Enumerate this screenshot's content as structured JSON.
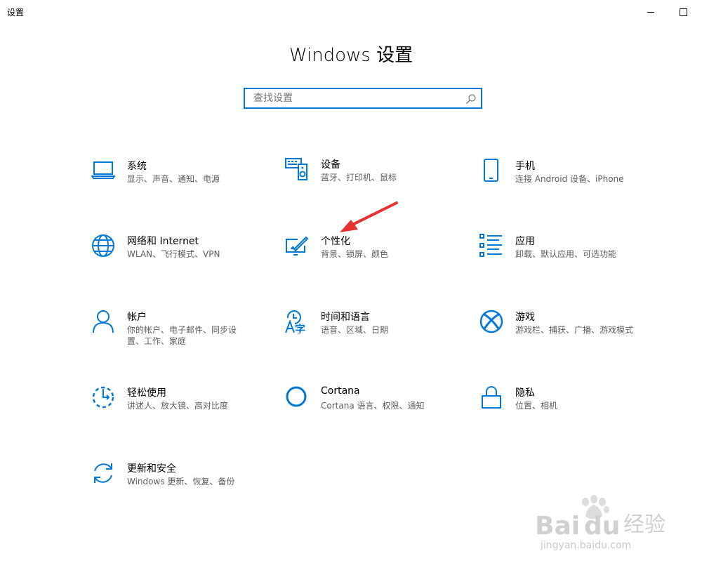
{
  "window": {
    "title": "设置"
  },
  "header": {
    "title": "Windows 设置"
  },
  "search": {
    "placeholder": "查找设置"
  },
  "tiles": [
    {
      "label": "系统",
      "desc": "显示、声音、通知、电源",
      "icon": "laptop-icon"
    },
    {
      "label": "设备",
      "desc": "蓝牙、打印机、鼠标",
      "icon": "keyboard-speaker-icon"
    },
    {
      "label": "手机",
      "desc": "连接 Android 设备、iPhone",
      "icon": "phone-icon"
    },
    {
      "label": "网络和 Internet",
      "desc": "WLAN、飞行模式、VPN",
      "icon": "globe-icon"
    },
    {
      "label": "个性化",
      "desc": "背景、锁屏、颜色",
      "icon": "pen-tablet-icon"
    },
    {
      "label": "应用",
      "desc": "卸载、默认应用、可选功能",
      "icon": "app-list-icon"
    },
    {
      "label": "帐户",
      "desc": "你的帐户、电子邮件、同步设置、工作、家庭",
      "icon": "person-icon"
    },
    {
      "label": "时间和语言",
      "desc": "语音、区域、日期",
      "icon": "time-language-icon"
    },
    {
      "label": "游戏",
      "desc": "游戏栏、捕获、广播、游戏模式",
      "icon": "xbox-icon"
    },
    {
      "label": "轻松使用",
      "desc": "讲述人、放大镜、高对比度",
      "icon": "ease-of-access-icon"
    },
    {
      "label": "Cortana",
      "desc": "Cortana 语言、权限、通知",
      "icon": "cortana-icon"
    },
    {
      "label": "隐私",
      "desc": "位置、相机",
      "icon": "lock-icon"
    },
    {
      "label": "更新和安全",
      "desc": "Windows 更新、恢复、备份",
      "icon": "refresh-icon"
    }
  ],
  "watermark": {
    "brand": "Bai",
    "brand2": "du",
    "suffix": "经验",
    "url": "jingyan.baidu.com"
  },
  "colors": {
    "accent": "#0078d7",
    "annotation_arrow": "#e8322f"
  }
}
